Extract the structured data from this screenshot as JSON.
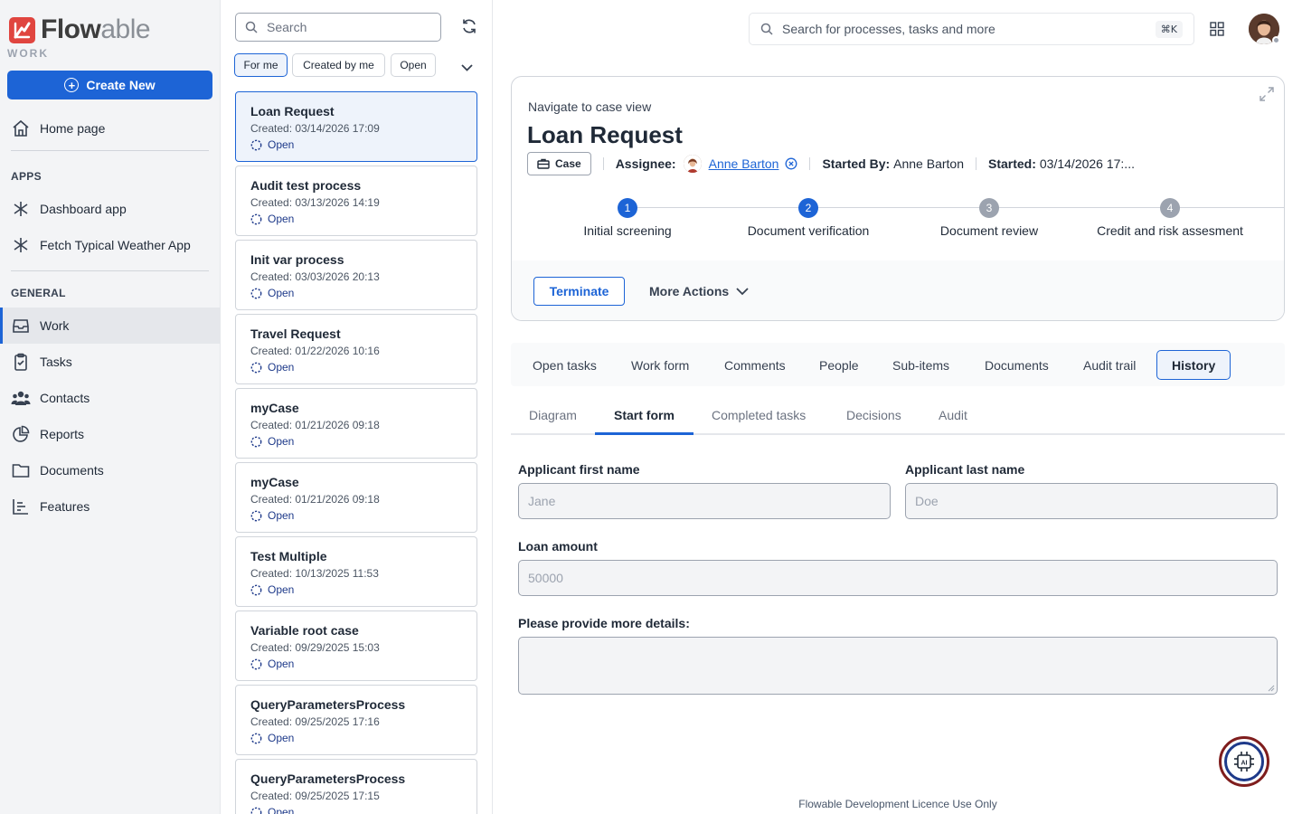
{
  "brand": {
    "name_a": "Flow",
    "name_b": "able",
    "sub": "WORK"
  },
  "sidebar": {
    "create_label": "Create New",
    "home_label": "Home page",
    "apps_heading": "APPS",
    "apps": [
      {
        "label": "Dashboard app",
        "icon": "asterisk-icon"
      },
      {
        "label": "Fetch Typical Weather App",
        "icon": "asterisk-icon"
      }
    ],
    "general_heading": "GENERAL",
    "general": [
      {
        "label": "Work",
        "icon": "inbox-icon",
        "active": true
      },
      {
        "label": "Tasks",
        "icon": "clipboard-icon"
      },
      {
        "label": "Contacts",
        "icon": "people-icon"
      },
      {
        "label": "Reports",
        "icon": "pie-chart-icon"
      },
      {
        "label": "Documents",
        "icon": "folder-icon"
      },
      {
        "label": "Features",
        "icon": "bar-chart-icon"
      }
    ]
  },
  "list": {
    "search_placeholder": "Search",
    "filters": [
      "For me",
      "Created by me",
      "Open"
    ],
    "items": [
      {
        "title": "Loan Request",
        "created": "Created: 03/14/2026 17:09",
        "status": "Open",
        "selected": true
      },
      {
        "title": "Audit test process",
        "created": "Created: 03/13/2026 14:19",
        "status": "Open"
      },
      {
        "title": "Init var process",
        "created": "Created: 03/03/2026 20:13",
        "status": "Open"
      },
      {
        "title": "Travel Request",
        "created": "Created: 01/22/2026 10:16",
        "status": "Open"
      },
      {
        "title": "myCase",
        "created": "Created: 01/21/2026 09:18",
        "status": "Open"
      },
      {
        "title": "myCase",
        "created": "Created: 01/21/2026 09:18",
        "status": "Open"
      },
      {
        "title": "Test Multiple",
        "created": "Created: 10/13/2025 11:53",
        "status": "Open"
      },
      {
        "title": "Variable root case",
        "created": "Created: 09/29/2025 15:03",
        "status": "Open"
      },
      {
        "title": "QueryParametersProcess",
        "created": "Created: 09/25/2025 17:16",
        "status": "Open"
      },
      {
        "title": "QueryParametersProcess",
        "created": "Created: 09/25/2025 17:15",
        "status": "Open"
      }
    ]
  },
  "topbar": {
    "search_placeholder": "Search for processes, tasks and more",
    "shortcut": "⌘K"
  },
  "case": {
    "navigate_label": "Navigate to case view",
    "title": "Loan Request",
    "tag": "Case",
    "assignee_label": "Assignee:",
    "assignee_name": "Anne Barton",
    "started_by_label": "Started By:",
    "started_by": "Anne Barton",
    "started_label": "Started:",
    "started": "03/14/2026 17:...",
    "steps": [
      {
        "num": "1",
        "label": "Initial screening",
        "state": "active"
      },
      {
        "num": "2",
        "label": "Document verification",
        "state": "active"
      },
      {
        "num": "3",
        "label": "Document review",
        "state": "pending"
      },
      {
        "num": "4",
        "label": "Credit and risk assesment",
        "state": "pending"
      }
    ],
    "terminate_label": "Terminate",
    "more_actions_label": "More Actions"
  },
  "tabs": [
    "Open tasks",
    "Work form",
    "Comments",
    "People",
    "Sub-items",
    "Documents",
    "Audit trail",
    "History"
  ],
  "active_tab": "History",
  "subtabs": [
    "Diagram",
    "Start form",
    "Completed tasks",
    "Decisions",
    "Audit"
  ],
  "active_subtab": "Start form",
  "form": {
    "first_name_label": "Applicant first name",
    "first_name_placeholder": "Jane",
    "last_name_label": "Applicant last name",
    "last_name_placeholder": "Doe",
    "amount_label": "Loan amount",
    "amount_placeholder": "50000",
    "details_label": "Please provide more details:"
  },
  "footer": "Flowable Development Licence Use Only",
  "colors": {
    "primary": "#1d64d6",
    "brand_red": "#e0453f",
    "pending_step": "#9ca3af"
  }
}
